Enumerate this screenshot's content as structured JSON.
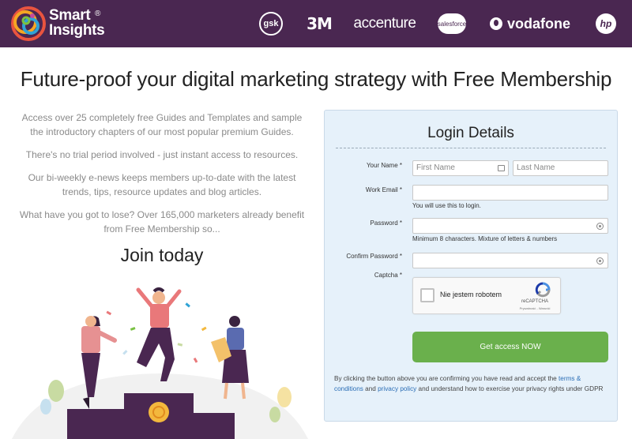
{
  "header": {
    "logo": {
      "line1": "Smart",
      "line2": "Insights",
      "reg": "®"
    },
    "brands": [
      {
        "name": "gsk",
        "label": "gsk"
      },
      {
        "name": "3m",
        "label": "3M"
      },
      {
        "name": "accenture",
        "label": "accenture"
      },
      {
        "name": "salesforce",
        "label": "salesforce"
      },
      {
        "name": "vodafone",
        "label": "vodafone"
      },
      {
        "name": "hp",
        "label": "hp"
      }
    ]
  },
  "headline": "Future-proof your digital marketing strategy with Free Membership",
  "intro": {
    "p1": "Access over 25 completely free Guides and Templates and sample the introductory chapters of our most popular premium Guides.",
    "p2": "There's no trial period involved - just instant access to resources.",
    "p3": "Our bi-weekly e-news keeps members up-to-date with the latest trends, tips, resource updates and blog articles.",
    "p4": "What have you got to lose? Over 165,000 marketers already benefit from Free Membership so..."
  },
  "join_heading": "Join today",
  "form": {
    "title": "Login Details",
    "name_label": "Your Name *",
    "first_name_placeholder": "First Name",
    "last_name_placeholder": "Last Name",
    "email_label": "Work Email *",
    "email_value": "",
    "email_hint": "You will use this to login.",
    "password_label": "Password *",
    "password_hint": "Minimum 8 characters. Mixture of letters & numbers",
    "confirm_label": "Confirm Password *",
    "captcha_label": "Captcha *",
    "captcha": {
      "checkbox_text": "Nie jestem robotem",
      "brand": "reCAPTCHA",
      "terms": "Prywatność - Warunki"
    },
    "submit_label": "Get access NOW",
    "legal": {
      "t1": "By clicking the button above you are confirming you have read and accept the",
      "link_terms": "terms & conditions",
      "t2": "and",
      "link_privacy": "privacy policy",
      "t3": "and understand how to exercise your privacy rights under GDPR"
    }
  },
  "colors": {
    "header_bg": "#4a2751",
    "panel_bg": "#e6f1fa",
    "button": "#6ab04c",
    "link": "#2a6db5"
  }
}
